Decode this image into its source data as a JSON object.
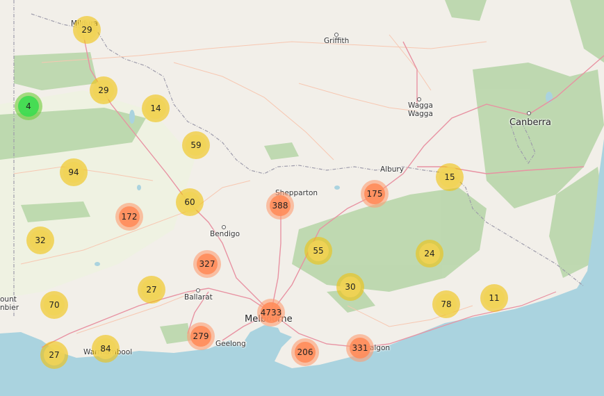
{
  "places": [
    {
      "id": "mildura",
      "name": "Mildura",
      "type": "town"
    },
    {
      "id": "griffith",
      "name": "Griffith",
      "type": "town"
    },
    {
      "id": "wagga-wagga-1",
      "name": "Wagga",
      "type": "town"
    },
    {
      "id": "wagga-wagga-2",
      "name": "Wagga",
      "type": "town"
    },
    {
      "id": "canberra",
      "name": "Canberra",
      "type": "city"
    },
    {
      "id": "albury",
      "name": "Albury",
      "type": "town"
    },
    {
      "id": "shepparton",
      "name": "Shepparton",
      "type": "town"
    },
    {
      "id": "bendigo",
      "name": "Bendigo",
      "type": "town"
    },
    {
      "id": "ballarat",
      "name": "Ballarat",
      "type": "town"
    },
    {
      "id": "melbourne",
      "name": "Melbourne",
      "type": "city"
    },
    {
      "id": "geelong",
      "name": "Geelong",
      "type": "town"
    },
    {
      "id": "warrnambool",
      "name": "Warrnambool",
      "type": "town"
    },
    {
      "id": "mount-gambier-1",
      "name": "ount",
      "type": "town"
    },
    {
      "id": "mount-gambier-2",
      "name": "nbier",
      "type": "town"
    },
    {
      "id": "traralgon",
      "name": "Traralgon",
      "type": "town"
    }
  ],
  "clusters": [
    {
      "count": "29",
      "size": "medium"
    },
    {
      "count": "29",
      "size": "medium"
    },
    {
      "count": "4",
      "size": "small"
    },
    {
      "count": "14",
      "size": "medium"
    },
    {
      "count": "59",
      "size": "medium"
    },
    {
      "count": "94",
      "size": "medium"
    },
    {
      "count": "60",
      "size": "medium"
    },
    {
      "count": "172",
      "size": "large"
    },
    {
      "count": "388",
      "size": "large"
    },
    {
      "count": "175",
      "size": "large"
    },
    {
      "count": "15",
      "size": "medium"
    },
    {
      "count": "32",
      "size": "medium"
    },
    {
      "count": "327",
      "size": "large"
    },
    {
      "count": "55",
      "size": "medium"
    },
    {
      "count": "24",
      "size": "medium"
    },
    {
      "count": "27",
      "size": "medium"
    },
    {
      "count": "30",
      "size": "medium"
    },
    {
      "count": "70",
      "size": "medium"
    },
    {
      "count": "4733",
      "size": "large"
    },
    {
      "count": "78",
      "size": "medium"
    },
    {
      "count": "11",
      "size": "medium"
    },
    {
      "count": "279",
      "size": "large"
    },
    {
      "count": "206",
      "size": "large"
    },
    {
      "count": "331",
      "size": "large"
    },
    {
      "count": "27",
      "size": "medium"
    },
    {
      "count": "84",
      "size": "medium"
    }
  ],
  "colors": {
    "land": "#f2efe9",
    "water": "#aad3df",
    "forest": "#add19e",
    "park": "#c8facc",
    "road_major": "#e892a2",
    "road_minor": "#f7c7b1",
    "border": "#9e9cab"
  }
}
